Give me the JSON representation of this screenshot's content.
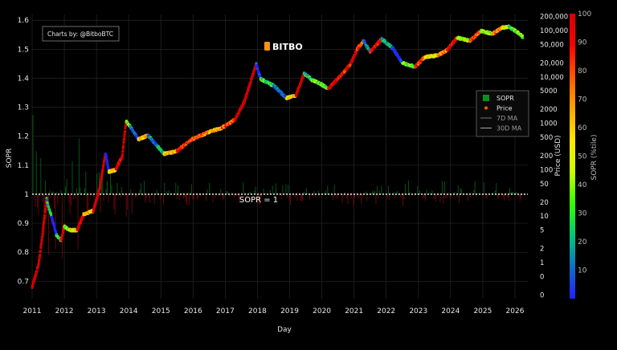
{
  "header": {
    "credit": "Charts by: @BitboBTC",
    "brand": "BITBO"
  },
  "chart_data": {
    "type": "scatter",
    "xlabel": "Day",
    "ylabel_left": "SOPR",
    "ylabel_price": "Price (USD)",
    "ylabel_colorbar": "SOPR (%tile)",
    "annotation": "SOPR = 1",
    "reference_line": 1,
    "xlim": [
      2011.0,
      2026.4
    ],
    "sopr_ylim": [
      0.64,
      1.62
    ],
    "sopr_ticks": [
      "0.7",
      "0.8",
      "0.9",
      "1",
      "1.1",
      "1.2",
      "1.3",
      "1.4",
      "1.5",
      "1.6"
    ],
    "year_ticks": [
      "2011",
      "2012",
      "2013",
      "2014",
      "2015",
      "2016",
      "2017",
      "2018",
      "2019",
      "2020",
      "2021",
      "2022",
      "2023",
      "2024",
      "2025",
      "2026"
    ],
    "price_ticks": [
      {
        "label": "200,000",
        "value": 200000
      },
      {
        "label": "100,000",
        "value": 100000
      },
      {
        "label": "50,000",
        "value": 50000
      },
      {
        "label": "20,000",
        "value": 20000
      },
      {
        "label": "10,000",
        "value": 10000
      },
      {
        "label": "5000",
        "value": 5000
      },
      {
        "label": "2000",
        "value": 2000
      },
      {
        "label": "1000",
        "value": 1000
      },
      {
        "label": "500",
        "value": 500
      },
      {
        "label": "200",
        "value": 200
      },
      {
        "label": "100",
        "value": 100
      },
      {
        "label": "50",
        "value": 50
      },
      {
        "label": "20",
        "value": 20
      },
      {
        "label": "10",
        "value": 10
      },
      {
        "label": "5",
        "value": 5
      },
      {
        "label": "2",
        "value": 2
      },
      {
        "label": "1",
        "value": 1
      },
      {
        "label": "0",
        "value": 0.5
      },
      {
        "label": "0",
        "value": 0.2
      }
    ],
    "colorbar_ticks": [
      "100",
      "90",
      "80",
      "70",
      "60",
      "50",
      "40",
      "30",
      "20",
      "10"
    ],
    "colorscale": [
      "#1e22ff",
      "#0f6ec8",
      "#00c87a",
      "#33ff00",
      "#c8ff00",
      "#ffe600",
      "#ffa500",
      "#ff5a00",
      "#ff0000",
      "#d40000"
    ],
    "legend": [
      {
        "label": "SOPR",
        "color": "#0a8f1f",
        "marker": "square"
      },
      {
        "label": "Price",
        "color": "#ff5a00",
        "marker": "dot"
      },
      {
        "label": "7D MA",
        "color": "#777777",
        "marker": "line"
      },
      {
        "label": "30D MA",
        "color": "#aaaaaa",
        "marker": "line"
      }
    ],
    "legend_position": "right",
    "price_series": [
      {
        "x": 2011.0,
        "y": 0.3
      },
      {
        "x": 2011.2,
        "y": 0.9
      },
      {
        "x": 2011.3,
        "y": 3
      },
      {
        "x": 2011.45,
        "y": 25
      },
      {
        "x": 2011.5,
        "y": 16
      },
      {
        "x": 2011.6,
        "y": 10
      },
      {
        "x": 2011.75,
        "y": 4
      },
      {
        "x": 2011.9,
        "y": 3
      },
      {
        "x": 2012.0,
        "y": 6
      },
      {
        "x": 2012.15,
        "y": 5
      },
      {
        "x": 2012.4,
        "y": 5
      },
      {
        "x": 2012.6,
        "y": 11
      },
      {
        "x": 2012.9,
        "y": 13
      },
      {
        "x": 2013.1,
        "y": 40
      },
      {
        "x": 2013.28,
        "y": 230
      },
      {
        "x": 2013.38,
        "y": 90
      },
      {
        "x": 2013.6,
        "y": 100
      },
      {
        "x": 2013.8,
        "y": 200
      },
      {
        "x": 2013.92,
        "y": 1100
      },
      {
        "x": 2014.05,
        "y": 850
      },
      {
        "x": 2014.3,
        "y": 450
      },
      {
        "x": 2014.6,
        "y": 550
      },
      {
        "x": 2014.9,
        "y": 320
      },
      {
        "x": 2015.1,
        "y": 220
      },
      {
        "x": 2015.5,
        "y": 250
      },
      {
        "x": 2015.9,
        "y": 430
      },
      {
        "x": 2016.5,
        "y": 650
      },
      {
        "x": 2016.9,
        "y": 800
      },
      {
        "x": 2017.3,
        "y": 1200
      },
      {
        "x": 2017.6,
        "y": 3000
      },
      {
        "x": 2017.96,
        "y": 19000
      },
      {
        "x": 2018.1,
        "y": 9000
      },
      {
        "x": 2018.5,
        "y": 6500
      },
      {
        "x": 2018.9,
        "y": 3500
      },
      {
        "x": 2019.2,
        "y": 4000
      },
      {
        "x": 2019.45,
        "y": 12000
      },
      {
        "x": 2019.7,
        "y": 8500
      },
      {
        "x": 2019.95,
        "y": 7200
      },
      {
        "x": 2020.2,
        "y": 5500
      },
      {
        "x": 2020.6,
        "y": 11000
      },
      {
        "x": 2020.9,
        "y": 19000
      },
      {
        "x": 2021.1,
        "y": 40000
      },
      {
        "x": 2021.3,
        "y": 60000
      },
      {
        "x": 2021.5,
        "y": 35000
      },
      {
        "x": 2021.86,
        "y": 65000
      },
      {
        "x": 2022.2,
        "y": 42000
      },
      {
        "x": 2022.5,
        "y": 20000
      },
      {
        "x": 2022.9,
        "y": 16500
      },
      {
        "x": 2023.2,
        "y": 27000
      },
      {
        "x": 2023.6,
        "y": 29000
      },
      {
        "x": 2023.9,
        "y": 38000
      },
      {
        "x": 2024.2,
        "y": 70000
      },
      {
        "x": 2024.6,
        "y": 60000
      },
      {
        "x": 2024.95,
        "y": 98000
      },
      {
        "x": 2025.3,
        "y": 85000
      },
      {
        "x": 2025.6,
        "y": 115000
      },
      {
        "x": 2025.8,
        "y": 120000
      },
      {
        "x": 2026.1,
        "y": 90000
      },
      {
        "x": 2026.25,
        "y": 72000
      }
    ]
  }
}
